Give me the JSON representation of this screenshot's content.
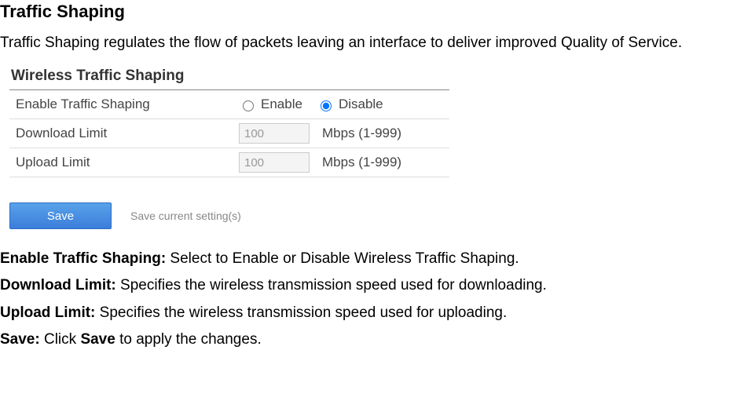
{
  "title": "Traffic Shaping",
  "intro": "Traffic Shaping regulates the flow of packets leaving an interface to deliver improved Quality of Service.",
  "panel": {
    "heading": "Wireless Traffic Shaping",
    "enable_label": "Enable Traffic Shaping",
    "enable_opt": "Enable",
    "disable_opt": "Disable",
    "download_label": "Download Limit",
    "download_value": "100",
    "download_unit": "Mbps (1-999)",
    "upload_label": "Upload Limit",
    "upload_value": "100",
    "upload_unit": "Mbps (1-999)"
  },
  "save": {
    "button": "Save",
    "hint": "Save current setting(s)"
  },
  "defs": {
    "enable_term": "Enable Traffic Shaping:",
    "enable_text": " Select to Enable or Disable Wireless Traffic Shaping.",
    "download_term": "Download Limit:",
    "download_text": " Specifies the wireless transmission speed used for downloading.",
    "upload_term": "Upload Limit:",
    "upload_text": " Specifies the wireless transmission speed used for uploading.",
    "save_term": "Save:",
    "save_text_pre": " Click ",
    "save_term2": "Save",
    "save_text_post": " to apply the changes."
  }
}
